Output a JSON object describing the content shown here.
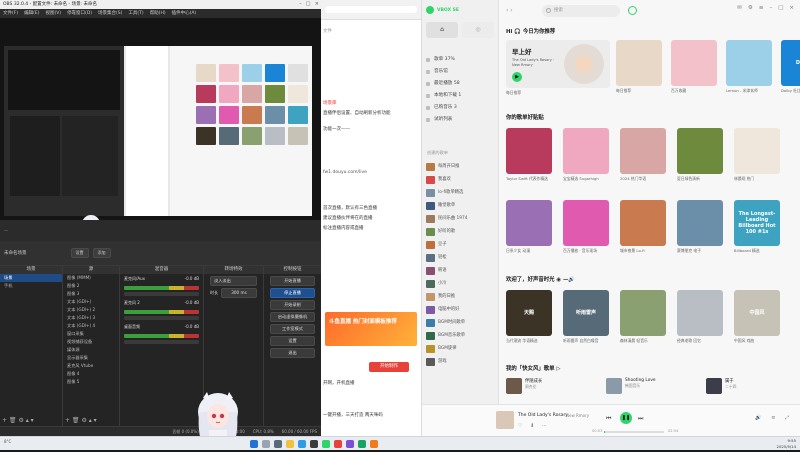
{
  "obs": {
    "title": "OBS 32.0.4 - 配置文件: 未命名 - 场景: 未命名",
    "menu": [
      "文件(F)",
      "编辑(E)",
      "视图(V)",
      "停靠窗口(D)",
      "场景集合(S)",
      "工具(T)",
      "帮助(H)",
      "插件中心(A)"
    ],
    "scenebar": {
      "scene_label": "未命名场景",
      "btn1": "设置",
      "btn2": "添加"
    },
    "docks": {
      "scenes": "场景",
      "sources": "源",
      "mixer": "混音器",
      "transitions": "转场特效",
      "controls": "控制按钮"
    },
    "scenes_list": [
      "场景",
      "手机"
    ],
    "sources_list": [
      "图像 (MMM)",
      "图像 2",
      "图像 3",
      "文本 (GDI+)",
      "文本 (GDI+) 2",
      "文本 (GDI+) 3",
      "文本 (GDI+) 4",
      "窗口采集",
      "视频捕获设备",
      "媒体源",
      "显示器采集",
      "麦克风 Vtube",
      "图像 4",
      "图像 5"
    ],
    "mixer": {
      "ch1": "麦克风/Aux",
      "ch1_db": "-0.0 dB",
      "ch2": "麦克风 2",
      "ch2_db": "-0.0 dB",
      "ch3": "桌面音频",
      "ch3_db": "-0.0 dB"
    },
    "transitions": {
      "type": "淡入淡出",
      "duration_label": "时长",
      "duration": "300 ms"
    },
    "controls": [
      "开始直播",
      "停止直播",
      "开始录制",
      "启动虚拟摄像机",
      "工作室模式",
      "设置",
      "退出"
    ],
    "status": {
      "rec": "00:00:00",
      "cpu": "CPU: 0.8%",
      "fps": "60.00 / 60.00 FPS",
      "bitrate": "0 kb/s",
      "frames": "丢帧 0 (0.0%)"
    }
  },
  "web": {
    "lines": [
      "文件",
      "场景库",
      "直播伴侣设置、自动刷新分析功能",
      "功能一次——",
      "fw1.douyu.com/live",
      "首次直播，默认有三色直播",
      "建议直播伙伴将在的直播",
      "标注直播内容或直播",
      "开始制作",
      "开网，开机直播",
      "一键开播，三天打造 两天咪码"
    ],
    "banner_text": "斗鱼直播 热门封面模板推荐",
    "button": "开始制作"
  },
  "music": {
    "top": {
      "tag": "VBOX SE",
      "search_placeholder": "搜索"
    },
    "nav": [
      "发现",
      "歌单 37%",
      "音乐馆",
      "最近播放 58",
      "本地和下载 1",
      "已购音乐 3",
      "试听列表"
    ],
    "my_playlists_label": "创建的歌单",
    "playlists": [
      {
        "name": "每周开日推",
        "color": "#b57b43"
      },
      {
        "name": "我喜欢",
        "color": "#d64a4a"
      },
      {
        "name": "lo-fi歌单精选",
        "color": "#7b8fa3"
      },
      {
        "name": "睡觉歌单",
        "color": "#3e5b7d"
      },
      {
        "name": "民间乐曲 1974",
        "color": "#9e7a5a"
      },
      {
        "name": "好听的歌",
        "color": "#6a8e4f"
      },
      {
        "name": "豆子",
        "color": "#c06f3a"
      },
      {
        "name": "轻松",
        "color": "#5c6f82"
      },
      {
        "name": "韩语",
        "color": "#8a4f6f"
      },
      {
        "name": "小冷",
        "color": "#4a6b5e"
      },
      {
        "name": "我的日推",
        "color": "#c2956a"
      },
      {
        "name": "电脑中的好",
        "color": "#7d5aa3"
      },
      {
        "name": "BGM时间歌单",
        "color": "#3b7fa8"
      },
      {
        "name": "BGM音乐歌单",
        "color": "#2f6b4a"
      },
      {
        "name": "BGM旋律",
        "color": "#b8922a"
      },
      {
        "name": "游戏",
        "color": "#5a5a5a"
      }
    ],
    "greeting": "Hi 🎧 今日为你推荐",
    "daily_card": {
      "title": "早上好",
      "sub": "The Old Lady's Rosary · New Rmory",
      "label": "每日推荐"
    },
    "top_cards": [
      {
        "cap": "每日推荐",
        "color": "#e8d8c8"
      },
      {
        "cap": "百万收藏",
        "color": "#f3c1c9"
      },
      {
        "cap": "Lemon - 米津玄师",
        "color": "#9bd0e8"
      },
      {
        "cap": "Dolby 杜比全景声",
        "color": "#1a84d6",
        "text": "Dolby"
      }
    ],
    "section2": "你的歌单好贴贴",
    "grid1": [
      {
        "cap": "Taylor Swift 代表作精选",
        "color": "#b83b5e"
      },
      {
        "cap": "宝宝精选 Sugarhigh",
        "color": "#f0a7c0"
      },
      {
        "cap": "2024 热门华语",
        "color": "#d9a6a6"
      },
      {
        "cap": "夏日绿色清新",
        "color": "#6e8b3d"
      },
      {
        "cap": "林晨曦 热门",
        "color": "#efe7dc"
      }
    ],
    "grid2": [
      {
        "cap": "日系少女 动漫",
        "color": "#9b6fb3"
      },
      {
        "cap": "百万播放 · 音乐现场",
        "color": "#e05ab0"
      },
      {
        "cap": "城市夜景 Lo-fi",
        "color": "#c97a4f"
      },
      {
        "cap": "赛博朋克 电子",
        "color": "#6b8fa8"
      },
      {
        "cap": "Billboard 精选",
        "color": "#3da3c0",
        "text": "The Longest-Leading Billboard Hot 100 #1s"
      }
    ],
    "section3": "欢迎了，好声音时光 ◉ —🔊",
    "grid3": [
      {
        "cap": "当代潮流 华语精选",
        "color": "#3a3326",
        "text": "天赐"
      },
      {
        "cap": "听雨雷声 自然白噪音",
        "color": "#566a78",
        "text": "听雨雷声"
      },
      {
        "cap": "森林清晨 轻音乐",
        "color": "#8aa070"
      },
      {
        "cap": "经典老歌 回忆",
        "color": "#b9bec4"
      },
      {
        "cap": "中国风 戏曲",
        "color": "#c6c3b6",
        "text": "中国风"
      }
    ],
    "section4": "我的「快女风」歌单 ▷",
    "mini": [
      {
        "title": "伴随成长",
        "sub": "周杰伦"
      },
      {
        "title": "Shooting Love",
        "sub": "韩国音乐"
      },
      {
        "title": "属于",
        "sub": "二十四"
      }
    ],
    "player": {
      "title": "The Old Lady's Rosary",
      "artist": "New Rmory",
      "time_cur": "00:03",
      "time_total": "02:54"
    }
  },
  "taskbar": {
    "time": "9:55",
    "date": "2025/5/14",
    "weather": "8°C"
  },
  "colors": {
    "accent_green": "#2fd46b",
    "obs_blue": "#1e4f8f",
    "live_red": "#e8413a"
  }
}
